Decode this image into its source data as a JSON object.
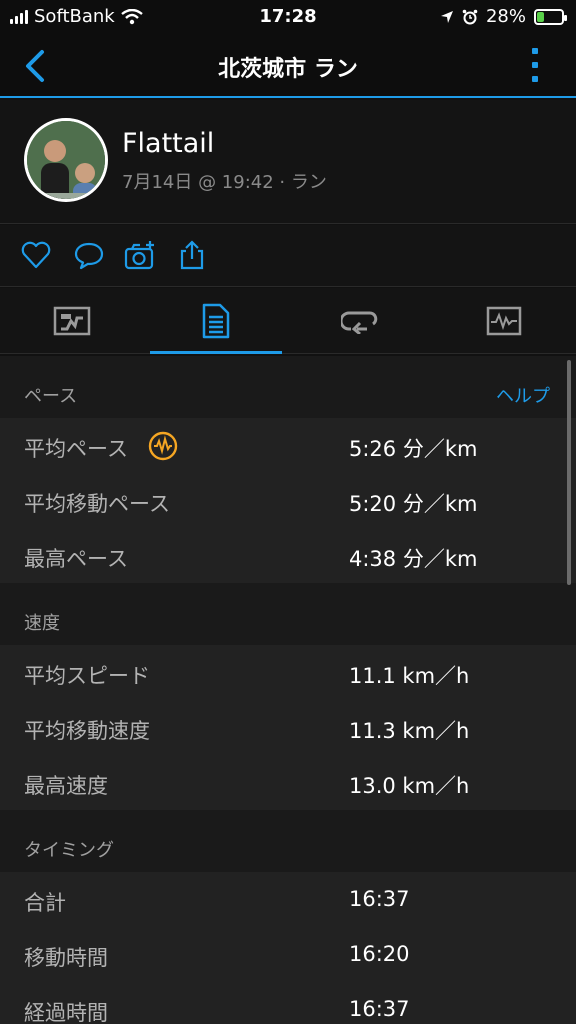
{
  "status": {
    "carrier": "SoftBank",
    "time": "17:28",
    "battery": "28%",
    "battery_level": 0.28
  },
  "nav": {
    "title": "北茨城市 ラン"
  },
  "profile": {
    "name": "Flattail",
    "meta": "7月14日 @ 19:42 · ラン"
  },
  "colors": {
    "accent": "#1e9be8",
    "pace_icon": "#f5a623"
  },
  "actions": [
    "heart-icon",
    "comment-icon",
    "add-photo-icon",
    "share-icon"
  ],
  "tabs": [
    "overview-map-icon",
    "stats-list-icon",
    "laps-icon",
    "charts-icon"
  ],
  "sections": {
    "pace": {
      "label": "ペース",
      "help": "ヘルプ",
      "rows": [
        {
          "name": "平均ペース",
          "value": "5:26 分／km"
        },
        {
          "name": "平均移動ペース",
          "value": "5:20 分／km"
        },
        {
          "name": "最高ペース",
          "value": "4:38 分／km"
        }
      ]
    },
    "speed": {
      "label": "速度",
      "rows": [
        {
          "name": "平均スピード",
          "value": "11.1 km／h"
        },
        {
          "name": "平均移動速度",
          "value": "11.3 km／h"
        },
        {
          "name": "最高速度",
          "value": "13.0 km／h"
        }
      ]
    },
    "timing": {
      "label": "タイミング",
      "rows": [
        {
          "name": "合計",
          "value": "16:37"
        },
        {
          "name": "移動時間",
          "value": "16:20"
        },
        {
          "name": "経過時間",
          "value": "16:37"
        }
      ]
    }
  }
}
